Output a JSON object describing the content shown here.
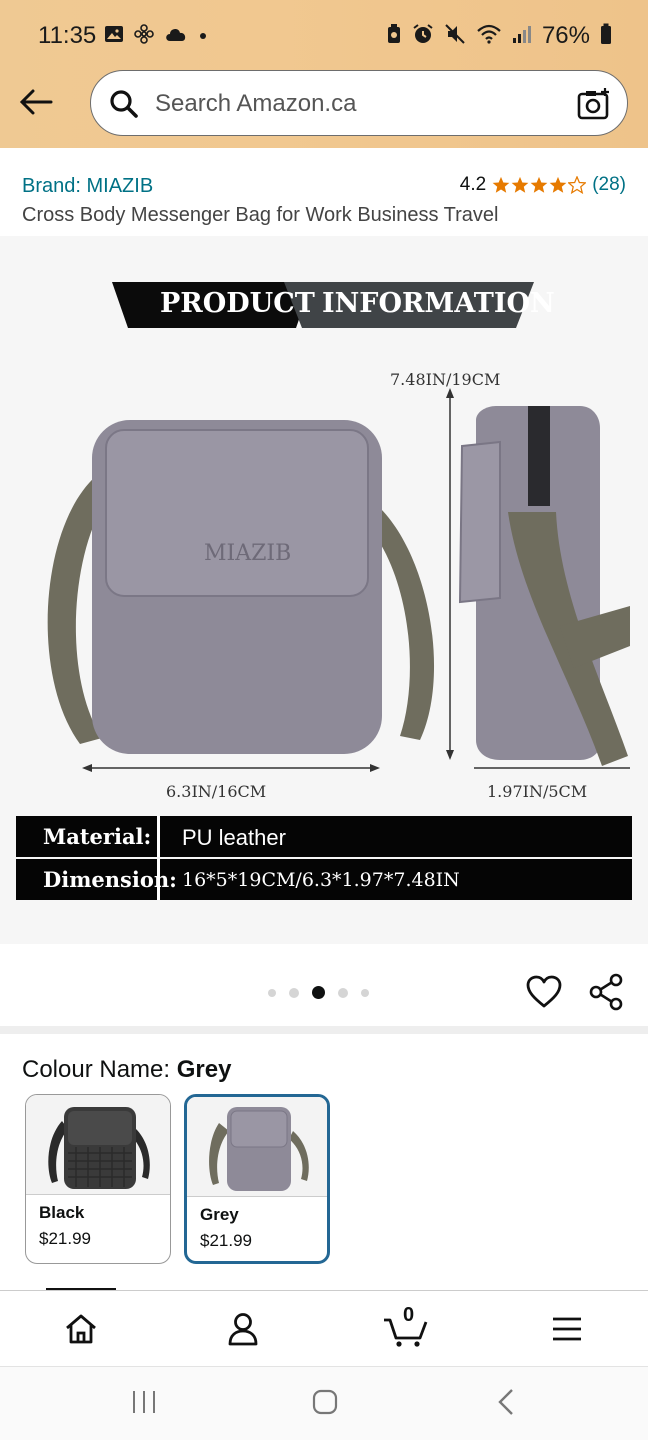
{
  "status_bar": {
    "time": "11:35",
    "battery": "76%",
    "left_icons": [
      "gallery-icon",
      "fan-icon",
      "cloud-icon",
      "dot-icon"
    ],
    "right_icons": [
      "battery-saver-icon",
      "alarm-icon",
      "mute-icon",
      "wifi-icon",
      "signal-icon",
      "battery-icon"
    ]
  },
  "search": {
    "placeholder": "Search Amazon.ca"
  },
  "product": {
    "brand": "Brand: MIAZIB",
    "rating": "4.2",
    "stars_value": 4.2,
    "review_count": "(28)",
    "title": "Cross Body Messenger Bag for Work Business Travel"
  },
  "image": {
    "banner_left": "PRODUCT",
    "banner_right": "INFORMATION",
    "logo_text": "MIAZIB",
    "height_dim": "7.48IN/19CM",
    "width_dim": "6.3IN/16CM",
    "depth_dim": "1.97IN/5CM",
    "specs": [
      {
        "key": "Material:",
        "value": "PU leather"
      },
      {
        "key": "Dimension:",
        "value": "16*5*19CM/6.3*1.97*7.48IN"
      }
    ]
  },
  "carousel": {
    "total": 5,
    "active_index": 2
  },
  "colour": {
    "label": "Colour Name: ",
    "selected": "Grey",
    "variants": [
      {
        "name": "Black",
        "price": "$21.99"
      },
      {
        "name": "Grey",
        "price": "$21.99"
      }
    ]
  },
  "nav": {
    "cart_count": "0",
    "items": [
      "home-icon",
      "account-icon",
      "cart-icon",
      "menu-icon"
    ]
  },
  "colors": {
    "header": "#f0c78f",
    "link": "#007185",
    "star": "#e67a00",
    "selected_border": "#236794"
  }
}
